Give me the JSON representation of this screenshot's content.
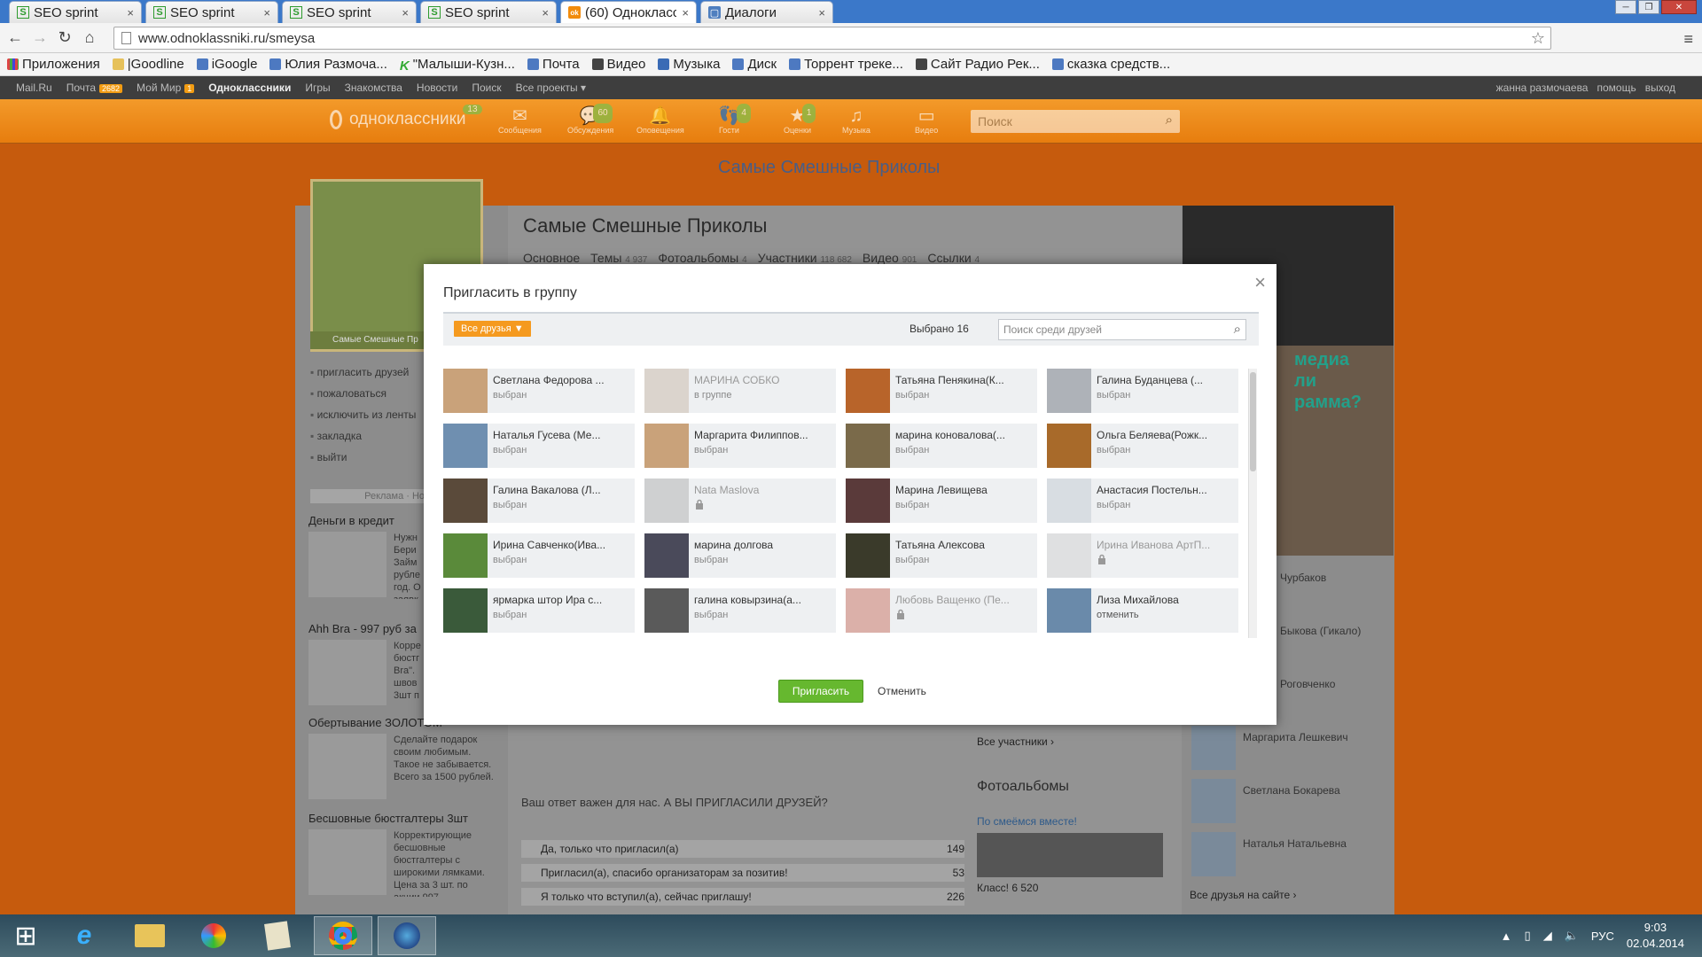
{
  "browser": {
    "tabs": [
      {
        "title": "SEO sprint",
        "icon": "seo"
      },
      {
        "title": "SEO sprint",
        "icon": "seo"
      },
      {
        "title": "SEO sprint",
        "icon": "seo"
      },
      {
        "title": "SEO sprint",
        "icon": "seo"
      },
      {
        "title": "(60) Одноклассники",
        "icon": "ok"
      },
      {
        "title": "Диалоги",
        "icon": "dlg"
      }
    ],
    "url": "www.odnoklassniki.ru/smeysa",
    "bookmarks": [
      "Приложения",
      "|Goodline",
      "iGoogle",
      "Юлия Размоча...",
      "\"Малыши-Кузн...",
      "Почта",
      "Видео",
      "Музыка",
      "Диск",
      "Торрент треке...",
      "Сайт Радио Рек...",
      "сказка средств..."
    ]
  },
  "mailbar": {
    "items": [
      "Mail.Ru",
      "Почта",
      "Мой Мир",
      "Одноклассники",
      "Игры",
      "Знакомства",
      "Новости",
      "Поиск",
      "Все проекты ▾"
    ],
    "mail_count": "2682",
    "mymir_count": "1",
    "user": "жанна размочаева",
    "help": "помощь",
    "logout": "выход"
  },
  "ok_header": {
    "logo": "одноклассники",
    "logo_badge": "13",
    "nav": [
      {
        "label": "Сообщения",
        "badge": ""
      },
      {
        "label": "Обсуждения",
        "badge": "60"
      },
      {
        "label": "Оповещения",
        "badge": ""
      },
      {
        "label": "Гости",
        "badge": "4"
      },
      {
        "label": "Оценки",
        "badge": "1"
      },
      {
        "label": "Музыка",
        "badge": ""
      },
      {
        "label": "Видео",
        "badge": ""
      }
    ],
    "search_placeholder": "Поиск"
  },
  "background_page": {
    "banner_title": "Самые Смешные Приколы",
    "group_name": "Самые Смешные Приколы",
    "tabs": [
      {
        "label": "Основное",
        "count": ""
      },
      {
        "label": "Темы",
        "count": "4 937"
      },
      {
        "label": "Фотоальбомы",
        "count": "4"
      },
      {
        "label": "Участники",
        "count": "118 682"
      },
      {
        "label": "Видео",
        "count": "901"
      },
      {
        "label": "Ссылки",
        "count": "4"
      }
    ],
    "avatar_caption": "Самые Смешные Пр",
    "side_links": [
      "пригласить друзей",
      "пожаловаться",
      "исключить из ленты",
      "закладка",
      "выйти"
    ],
    "ads_header": "Реклама · Нов",
    "ads": [
      {
        "title": "Деньги в кредит",
        "text": "Нужн Бери Займ рубле год. О заявк"
      },
      {
        "title": "Ahh Bra - 997 руб за",
        "text": "Корре бюстг Bra\". швов 3шт п"
      },
      {
        "title": "Обертывание ЗОЛОТОМ",
        "text": "Сделайте подарок своим любимым. Такое не забывается. Всего за 1500 рублей."
      },
      {
        "title": "Бесшовные бюстгалтеры 3шт",
        "text": "Корректирующие бесшовные бюстгалтеры с широкими лямками. Цена за 3 шт. по акции 997"
      }
    ],
    "poll": {
      "question": "Ваш ответ важен для нас. А ВЫ ПРИГЛАСИЛИ ДРУЗЕЙ?",
      "options": [
        {
          "label": "Да, только что пригласил(а)",
          "count": "149"
        },
        {
          "label": "Пригласил(а), спасибо организаторам за позитив!",
          "count": "53"
        },
        {
          "label": "Я только что вступил(а), сейчас приглашу!",
          "count": "226"
        }
      ]
    },
    "all_members": "Все участники ›",
    "photo_albums": "Фотоальбомы",
    "album_name": "По смеёмся вместе!",
    "album_klass": "Класс! 6 520",
    "promo_text": [
      "медиа",
      "ли",
      "рамма?"
    ],
    "right_friends": [
      "Чурбаков",
      "Быкова (Гикало)",
      "Роговченко",
      "Маргарита Лешкевич",
      "Светлана Бокарева",
      "Наталья Натальевна"
    ],
    "all_friends": "Все друзья на сайте ›"
  },
  "modal": {
    "title": "Пригласить в группу",
    "close": "×",
    "filter_label": "Все друзья ▼",
    "selected": "Выбрано 16",
    "search_placeholder": "Поиск среди друзей",
    "friends": [
      {
        "name": "Светлана Федорова ...",
        "status": "выбран",
        "disabled": false,
        "color": "#c9a27a"
      },
      {
        "name": "МАРИНА СОБКО",
        "status": "в группе",
        "disabled": true,
        "color": "#c8b8a8"
      },
      {
        "name": "Татьяна Пенякина(К...",
        "status": "выбран",
        "disabled": false,
        "color": "#b8642a"
      },
      {
        "name": "Галина Буданцева (...",
        "status": "выбран",
        "disabled": false,
        "color": "#aeb2b8"
      },
      {
        "name": "Наталья Гусева (Ме...",
        "status": "выбран",
        "disabled": false,
        "color": "#6f8fb0"
      },
      {
        "name": "Маргарита Филиппов...",
        "status": "выбран",
        "disabled": false,
        "color": "#c9a27a"
      },
      {
        "name": "марина коновалова(...",
        "status": "выбран",
        "disabled": false,
        "color": "#7a6a4a"
      },
      {
        "name": "Ольга Беляева(Рожк...",
        "status": "выбран",
        "disabled": false,
        "color": "#a86a2a"
      },
      {
        "name": "Галина Вакалова (Л...",
        "status": "выбран",
        "disabled": false,
        "color": "#5a4a3a"
      },
      {
        "name": "Nata Maslova",
        "status": "",
        "disabled": true,
        "color": "#b0b0b0"
      },
      {
        "name": "Марина Левищева",
        "status": "выбран",
        "disabled": false,
        "color": "#5a3a3a"
      },
      {
        "name": "Анастасия Постельн...",
        "status": "выбран",
        "disabled": false,
        "color": "#d8dde2"
      },
      {
        "name": "Ирина Савченко(Ива...",
        "status": "выбран",
        "disabled": false,
        "color": "#5a8a3a"
      },
      {
        "name": "марина долгова",
        "status": "выбран",
        "disabled": false,
        "color": "#4a4a5a"
      },
      {
        "name": "Татьяна Алексова",
        "status": "выбран",
        "disabled": false,
        "color": "#3a3a2a"
      },
      {
        "name": "Ирина Иванова АртП...",
        "status": "",
        "disabled": true,
        "color": "#d0d0d0"
      },
      {
        "name": "ярмарка штор Ира с...",
        "status": "выбран",
        "disabled": false,
        "color": "#3a5a3a"
      },
      {
        "name": "галина ковырзина(а...",
        "status": "выбран",
        "disabled": false,
        "color": "#5a5a5a"
      },
      {
        "name": "Любовь Ващенко (Пе...",
        "status": "",
        "disabled": true,
        "color": "#c87060"
      },
      {
        "name": "Лиза Михайлова",
        "status": "отменить",
        "disabled": false,
        "color": "#6a8aaa"
      }
    ],
    "invite_button": "Пригласить",
    "cancel_button": "Отменить"
  },
  "taskbar": {
    "lang": "РУС",
    "time": "9:03",
    "date": "02.04.2014"
  }
}
